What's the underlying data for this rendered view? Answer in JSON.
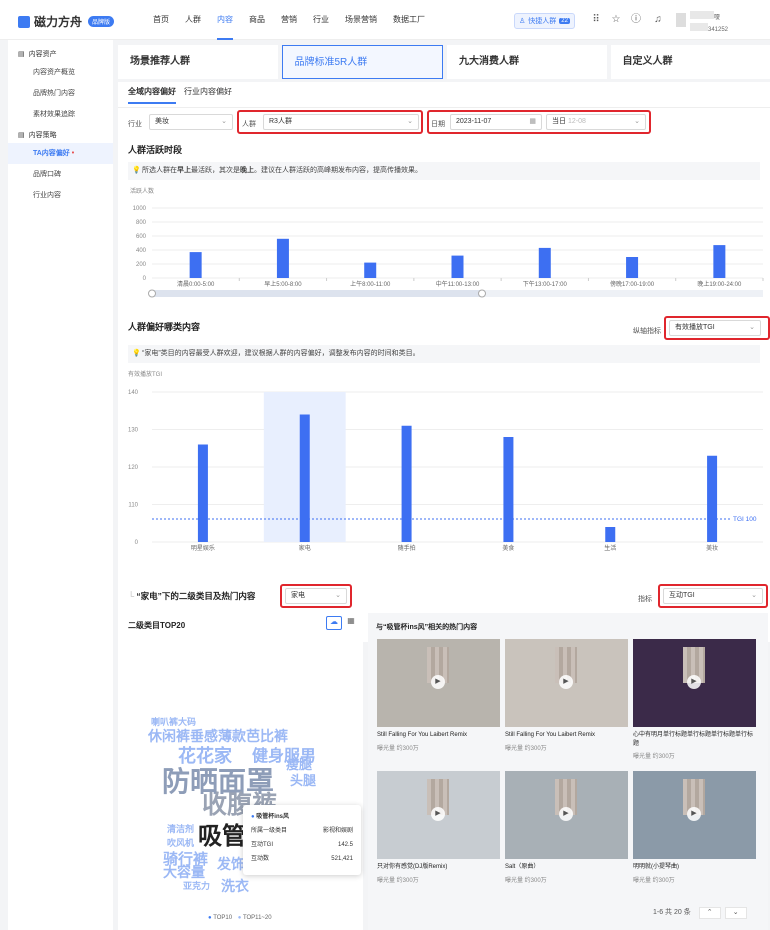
{
  "app": {
    "name": "磁力方舟",
    "badge": "品牌版"
  },
  "nav": [
    "首页",
    "人群",
    "内容",
    "商品",
    "营销",
    "行业",
    "场景营销",
    "数据工厂"
  ],
  "nav_active": "内容",
  "quick": {
    "label": "快捷人群",
    "count": "22"
  },
  "user": {
    "line1": "嗄",
    "line2": "341252"
  },
  "sidebar": {
    "groups": [
      {
        "label": "内容资产",
        "items": [
          "内容资产概览",
          "品牌热门内容",
          "素材效果追踪"
        ]
      },
      {
        "label": "内容策略",
        "items": [
          "TA内容偏好",
          "品牌口碑",
          "行业内容"
        ]
      }
    ],
    "active": "TA内容偏好"
  },
  "top_cards": [
    "场景推荐人群",
    "品牌标准5R人群",
    "九大消费人群",
    "自定义人群"
  ],
  "tabs": [
    "全域内容偏好",
    "行业内容偏好"
  ],
  "filters": {
    "industry_label": "行业",
    "industry": "美妆",
    "crowd_label": "人群",
    "crowd": "R3人群",
    "date_label": "日期",
    "date": "2023-11-07",
    "period": "当日",
    "period_hint": "12-08"
  },
  "active_time": {
    "title": "人群活跃时段",
    "tip_prefix": "所选人群在",
    "tip_b1": "早上",
    "tip_mid": "最活跃，其次是",
    "tip_b2": "晚上",
    "tip_suffix": "。建议在人群活跃的高峰期发布内容，提高传播效果。"
  },
  "preference": {
    "title": "人群偏好哪类内容",
    "axis_label": "纵轴指标",
    "axis_metric": "有效播放TGI",
    "tip": "“家电”类目的内容最受人群欢迎，建议根据人群的内容偏好，调整发布内容的时间和类目。"
  },
  "secondary": {
    "title_pre": "“家电”下的二级类目及热门内容",
    "category": "家电",
    "metric_label": "指标",
    "metric": "互动TGI",
    "left_title": "二级类目TOP20",
    "right_title": "与“吸管杯ins风”相关的热门内容"
  },
  "cloud_words": [
    "喇叭裤大码",
    "休闲裤垂感薄款芭比裤",
    "花花家",
    "健身服男",
    "防晒面罩",
    "瘦腿",
    "头腿",
    "收腹裤",
    "包包",
    "清洁剂",
    "吸管杯ins风",
    "吹风机",
    "骑行裤",
    "发饰",
    "大容量",
    "亚克力",
    "洗衣"
  ],
  "tooltip": {
    "title": "吸管杯ins风",
    "rows": [
      [
        "所属一级类目",
        "影视和娱剧"
      ],
      [
        "互动TGI",
        "142.5"
      ],
      [
        "互动数",
        "521,421"
      ]
    ]
  },
  "legend": [
    "TOP10",
    "TOP11~20"
  ],
  "hot_cards": [
    {
      "title": "Still Falling For You Laibert Remix",
      "meta": "曝光量 约300万"
    },
    {
      "title": "Still Falling For You Laibert Remix",
      "meta": "曝光量 约300万"
    },
    {
      "title": "心中有明月单行标题单行标题单行标题单行标题",
      "meta": "曝光量 约300万"
    },
    {
      "title": "只对你有感觉(DJ版Remix)",
      "meta": "曝光量 约300万"
    },
    {
      "title": "Salt（原曲）",
      "meta": "曝光量 约300万"
    },
    {
      "title": "明明就(小提琴曲)",
      "meta": "曝光量 约300万"
    }
  ],
  "pagination": "1-6 共 20 条",
  "chart_data": [
    {
      "type": "bar",
      "title": "人群活跃时段",
      "ylabel": "活跃人数",
      "ylim": [
        0,
        1000
      ],
      "yticks": [
        0,
        200,
        400,
        600,
        800,
        1000
      ],
      "categories": [
        "清晨0:00-5:00",
        "早上5:00-8:00",
        "上午8:00-11:00",
        "中午11:00-13:00",
        "下午13:00-17:00",
        "傍晚17:00-19:00",
        "晚上19:00-24:00"
      ],
      "values": [
        370,
        560,
        220,
        320,
        430,
        300,
        470
      ]
    },
    {
      "type": "bar",
      "title": "人群偏好哪类内容",
      "ylabel": "有效播放TGI",
      "ylim": [
        0,
        140
      ],
      "yticks": [
        0,
        110,
        120,
        130,
        140
      ],
      "categories": [
        "明星娱乐",
        "家电",
        "随手拍",
        "美食",
        "生活",
        "美妆"
      ],
      "values": [
        126,
        134,
        131,
        128,
        104,
        123
      ],
      "reference": {
        "label": "TGI",
        "value": 100
      }
    }
  ]
}
